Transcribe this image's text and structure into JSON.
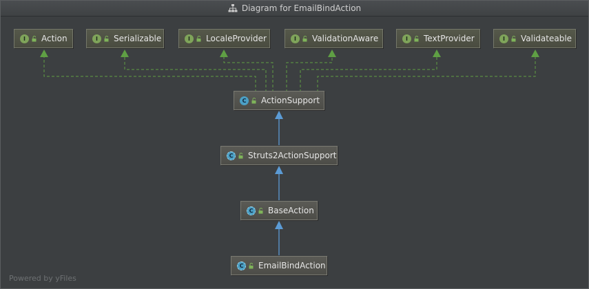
{
  "window": {
    "title": "Diagram for EmailBindAction",
    "title_icon": "hierarchy-icon"
  },
  "watermark": "Powered by yFiles",
  "colors": {
    "implements_edge": "#5f9f44",
    "extends_edge": "#5b9bd5",
    "interface_badge": "#7fa45a",
    "class_badge": "#4b9fc4"
  },
  "nodes": {
    "action": {
      "label": "Action",
      "kind": "interface",
      "badge": "I"
    },
    "serializable": {
      "label": "Serializable",
      "kind": "interface",
      "badge": "I"
    },
    "locale_provider": {
      "label": "LocaleProvider",
      "kind": "interface",
      "badge": "I"
    },
    "validation_aware": {
      "label": "ValidationAware",
      "kind": "interface",
      "badge": "I"
    },
    "text_provider": {
      "label": "TextProvider",
      "kind": "interface",
      "badge": "I"
    },
    "validateable": {
      "label": "Validateable",
      "kind": "interface",
      "badge": "I"
    },
    "action_support": {
      "label": "ActionSupport",
      "kind": "class",
      "badge": "C"
    },
    "struts2_action_support": {
      "label": "Struts2ActionSupport",
      "kind": "class",
      "badge": "C"
    },
    "base_action": {
      "label": "BaseAction",
      "kind": "class",
      "badge": "C"
    },
    "email_bind_action": {
      "label": "EmailBindAction",
      "kind": "class",
      "badge": "C"
    }
  }
}
